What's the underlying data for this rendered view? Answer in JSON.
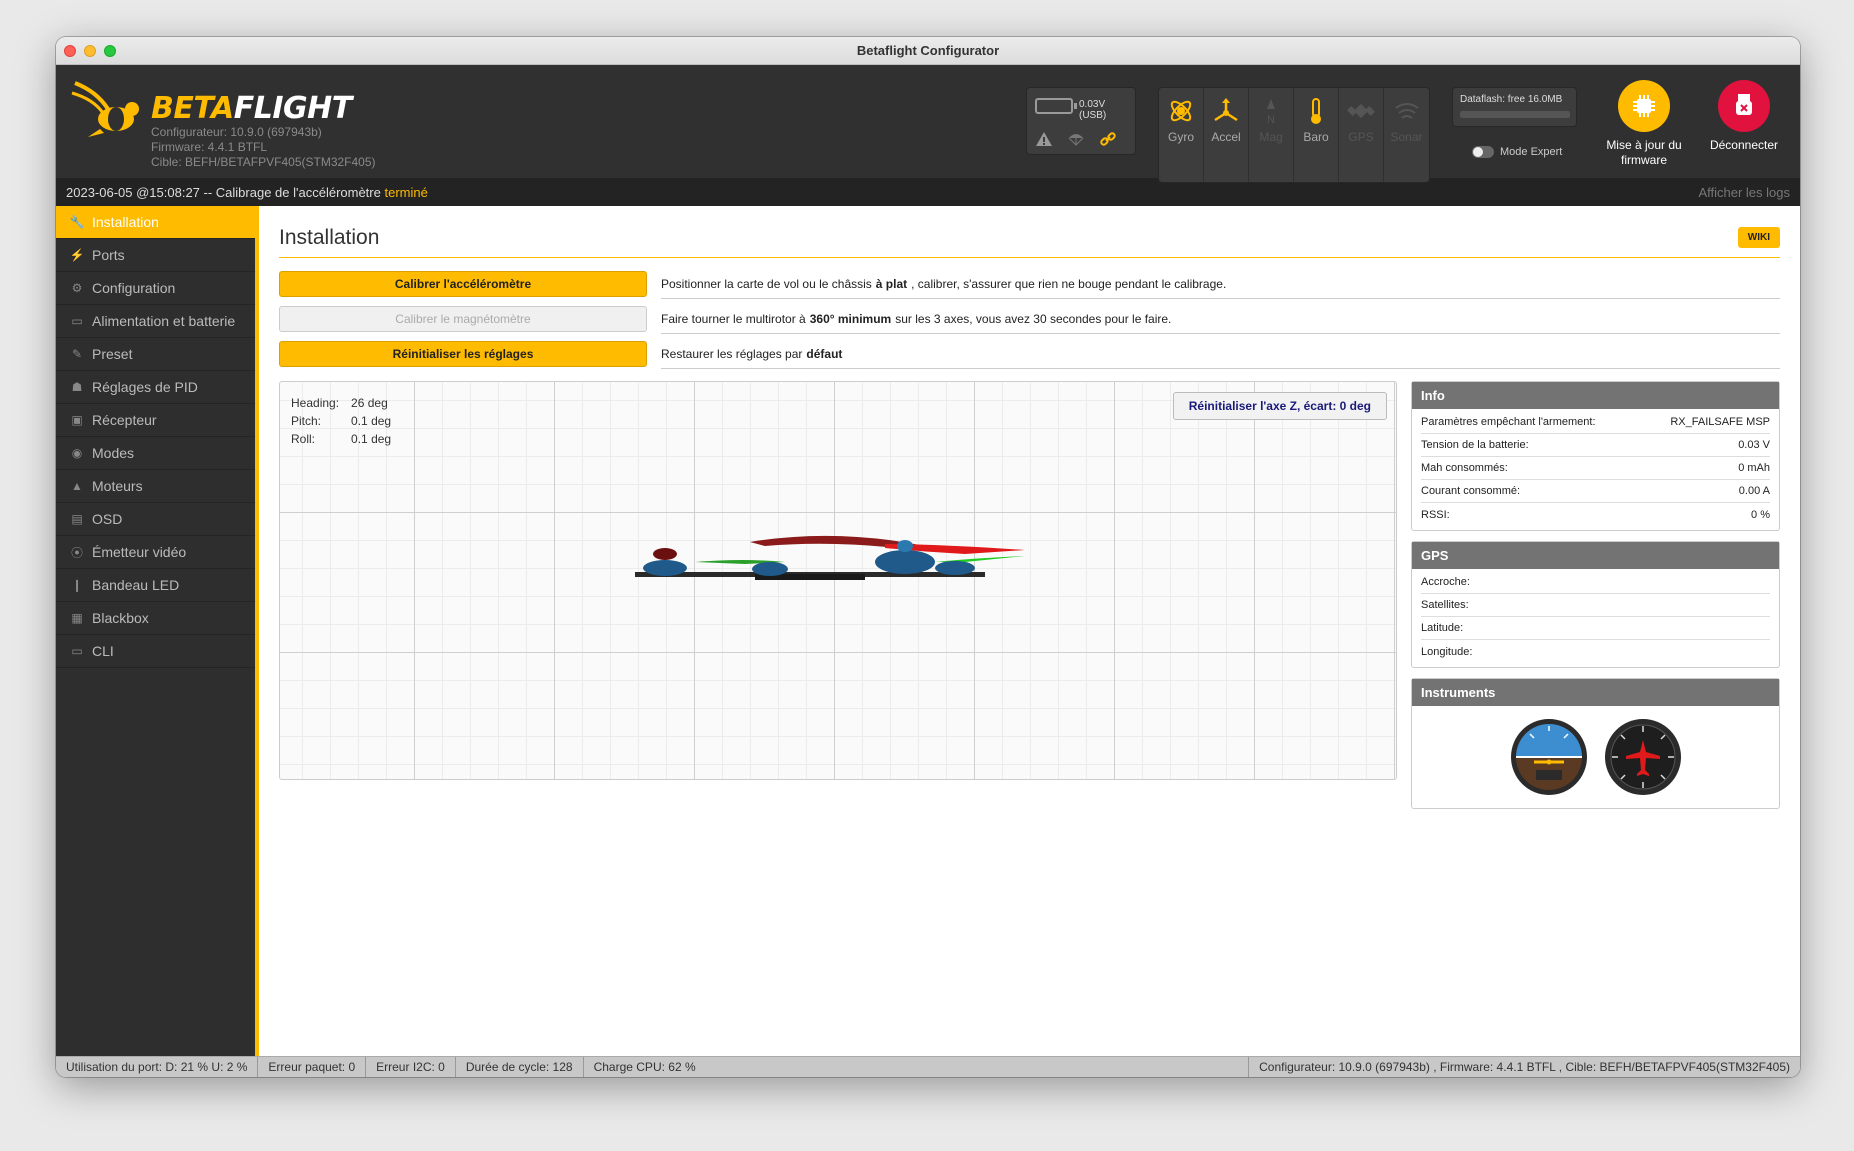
{
  "window": {
    "title": "Betaflight Configurator"
  },
  "header": {
    "brand_part1": "BETA",
    "brand_part2": "FLIGHT",
    "configurator_version": "Configurateur: 10.9.0 (697943b)",
    "firmware": "Firmware: 4.4.1 BTFL",
    "target": "Cible: BEFH/BETAFPVF405(STM32F405)",
    "battery_voltage": "0.03V (USB)",
    "sensors": [
      {
        "label": "Gyro",
        "icon": "gyro-icon",
        "active": true
      },
      {
        "label": "Accel",
        "icon": "accel-icon",
        "active": true
      },
      {
        "label": "Mag",
        "icon": "mag-icon",
        "active": false
      },
      {
        "label": "Baro",
        "icon": "baro-icon",
        "active": true
      },
      {
        "label": "GPS",
        "icon": "gps-icon",
        "active": false
      },
      {
        "label": "Sonar",
        "icon": "sonar-icon",
        "active": false
      }
    ],
    "dataflash": "Dataflash: free 16.0MB",
    "expert_mode_label": "Mode Expert",
    "firmware_update_label_1": "Mise à jour du",
    "firmware_update_label_2": "firmware",
    "disconnect_label": "Déconnecter"
  },
  "log": {
    "message": "2023-06-05 @15:08:27 -- Calibrage de l'accéléromètre",
    "status": "terminé",
    "show_logs": "Afficher les logs"
  },
  "sidebar": {
    "items": [
      {
        "label": "Installation",
        "icon": "wrench-icon",
        "active": true
      },
      {
        "label": "Ports",
        "icon": "plug-icon",
        "active": false
      },
      {
        "label": "Configuration",
        "icon": "gear-icon",
        "active": false
      },
      {
        "label": "Alimentation et batterie",
        "icon": "battery-icon",
        "active": false
      },
      {
        "label": "Preset",
        "icon": "wand-icon",
        "active": false
      },
      {
        "label": "Réglages de PID",
        "icon": "sitemap-icon",
        "active": false
      },
      {
        "label": "Récepteur",
        "icon": "receiver-icon",
        "active": false
      },
      {
        "label": "Modes",
        "icon": "modes-icon",
        "active": false
      },
      {
        "label": "Moteurs",
        "icon": "motor-icon",
        "active": false
      },
      {
        "label": "OSD",
        "icon": "osd-icon",
        "active": false
      },
      {
        "label": "Émetteur vidéo",
        "icon": "broadcast-icon",
        "active": false
      },
      {
        "label": "Bandeau LED",
        "icon": "led-icon",
        "active": false
      },
      {
        "label": "Blackbox",
        "icon": "blackbox-icon",
        "active": false
      },
      {
        "label": "CLI",
        "icon": "terminal-icon",
        "active": false
      }
    ]
  },
  "main": {
    "title": "Installation",
    "wiki_label": "WIKI",
    "actions": [
      {
        "button": "Calibrer l'accéléromètre",
        "enabled": true,
        "desc_pre": "Positionner la carte de vol ou le châssis",
        "desc_bold": "à plat",
        "desc_post": ", calibrer, s'assurer que rien ne bouge pendant le calibrage."
      },
      {
        "button": "Calibrer le magnétomètre",
        "enabled": false,
        "desc_pre": "Faire tourner le multirotor à",
        "desc_bold": "360° minimum",
        "desc_post": "sur les 3 axes, vous avez 30 secondes pour le faire."
      },
      {
        "button": "Réinitialiser les réglages",
        "enabled": true,
        "desc_pre": "Restaurer les réglages par",
        "desc_bold": "défaut",
        "desc_post": ""
      }
    ],
    "attitude": {
      "heading_label": "Heading:",
      "heading_value": "26 deg",
      "pitch_label": "Pitch:",
      "pitch_value": "0.1 deg",
      "roll_label": "Roll:",
      "roll_value": "0.1 deg"
    },
    "reset_z_label": "Réinitialiser l'axe Z, écart: 0 deg"
  },
  "info_panel": {
    "title": "Info",
    "rows": [
      {
        "label": "Paramètres empêchant l'armement:",
        "value": "RX_FAILSAFE  MSP"
      },
      {
        "label": "Tension de la batterie:",
        "value": "0.03 V"
      },
      {
        "label": "Mah consommés:",
        "value": "0 mAh"
      },
      {
        "label": "Courant consommé:",
        "value": "0.00 A"
      },
      {
        "label": "RSSI:",
        "value": "0 %"
      }
    ]
  },
  "gps_panel": {
    "title": "GPS",
    "rows": [
      {
        "label": "Accroche:",
        "value": ""
      },
      {
        "label": "Satellites:",
        "value": ""
      },
      {
        "label": "Latitude:",
        "value": ""
      },
      {
        "label": "Longitude:",
        "value": ""
      }
    ]
  },
  "instruments_panel": {
    "title": "Instruments"
  },
  "status_bar": {
    "port_usage": "Utilisation du port: D: 21 % U: 2 %",
    "packet_error": "Erreur paquet: 0",
    "i2c_error": "Erreur I2C: 0",
    "cycle_time": "Durée de cycle: 128",
    "cpu_load": "Charge CPU: 62 %",
    "versions": "Configurateur: 10.9.0 (697943b) , Firmware: 4.4.1 BTFL , Cible: BEFH/BETAFPVF405(STM32F405)"
  },
  "colors": {
    "accent": "#ffbb00",
    "disconnect": "#e2123f",
    "header_bg": "#303030",
    "sidebar_bg": "#2e2e2e"
  }
}
